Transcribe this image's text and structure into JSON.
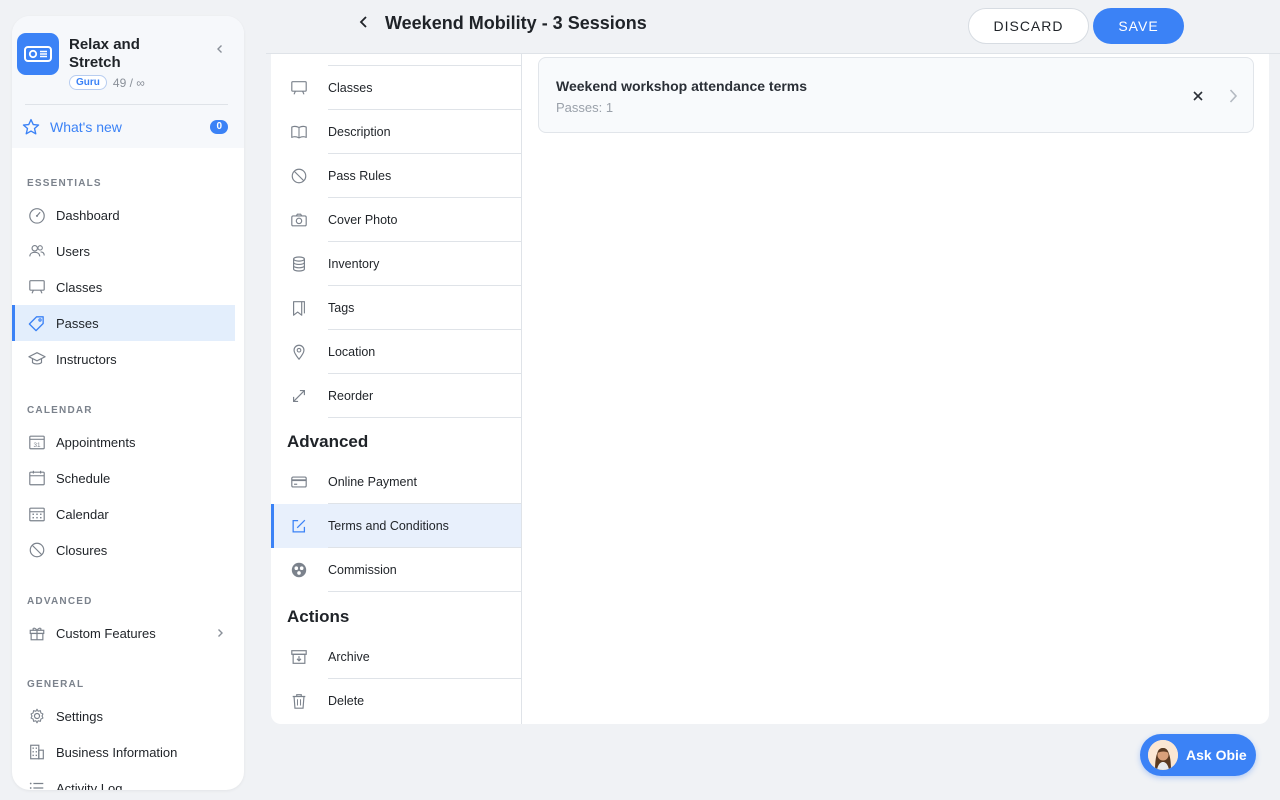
{
  "sidebar": {
    "business_name": "Relax and Stretch",
    "plan": "Guru",
    "quota": "49 / ∞",
    "whats_new": {
      "label": "What's new",
      "count": "0"
    },
    "sections": {
      "essentials": "ESSENTIALS",
      "calendar": "CALENDAR",
      "advanced": "ADVANCED",
      "general": "GENERAL"
    },
    "items": {
      "dashboard": "Dashboard",
      "users": "Users",
      "classes": "Classes",
      "passes": "Passes",
      "instructors": "Instructors",
      "appointments": "Appointments",
      "schedule": "Schedule",
      "calendar": "Calendar",
      "closures": "Closures",
      "custom_features": "Custom Features",
      "settings": "Settings",
      "business_information": "Business Information",
      "activity_log": "Activity Log"
    },
    "active_item": "Passes",
    "calendar_icon_day": "31"
  },
  "header": {
    "title": "Weekend Mobility - 3 Sessions",
    "discard_label": "DISCARD",
    "save_label": "SAVE"
  },
  "subnav": {
    "items": [
      "Classes",
      "Description",
      "Pass Rules",
      "Cover Photo",
      "Inventory",
      "Tags",
      "Location",
      "Reorder"
    ],
    "advanced_heading": "Advanced",
    "advanced_items": [
      "Online Payment",
      "Terms and Conditions",
      "Commission"
    ],
    "actions_heading": "Actions",
    "action_items": [
      "Archive",
      "Delete"
    ],
    "active_item": "Terms and Conditions"
  },
  "terms_card": {
    "title": "Weekend workshop attendance terms",
    "subtitle": "Passes: 1"
  },
  "assistant": {
    "label": "Ask Obie"
  },
  "colors": {
    "accent": "#3b82f6",
    "active_bg": "#e3eefc",
    "page_bg": "#f0f2f5"
  }
}
